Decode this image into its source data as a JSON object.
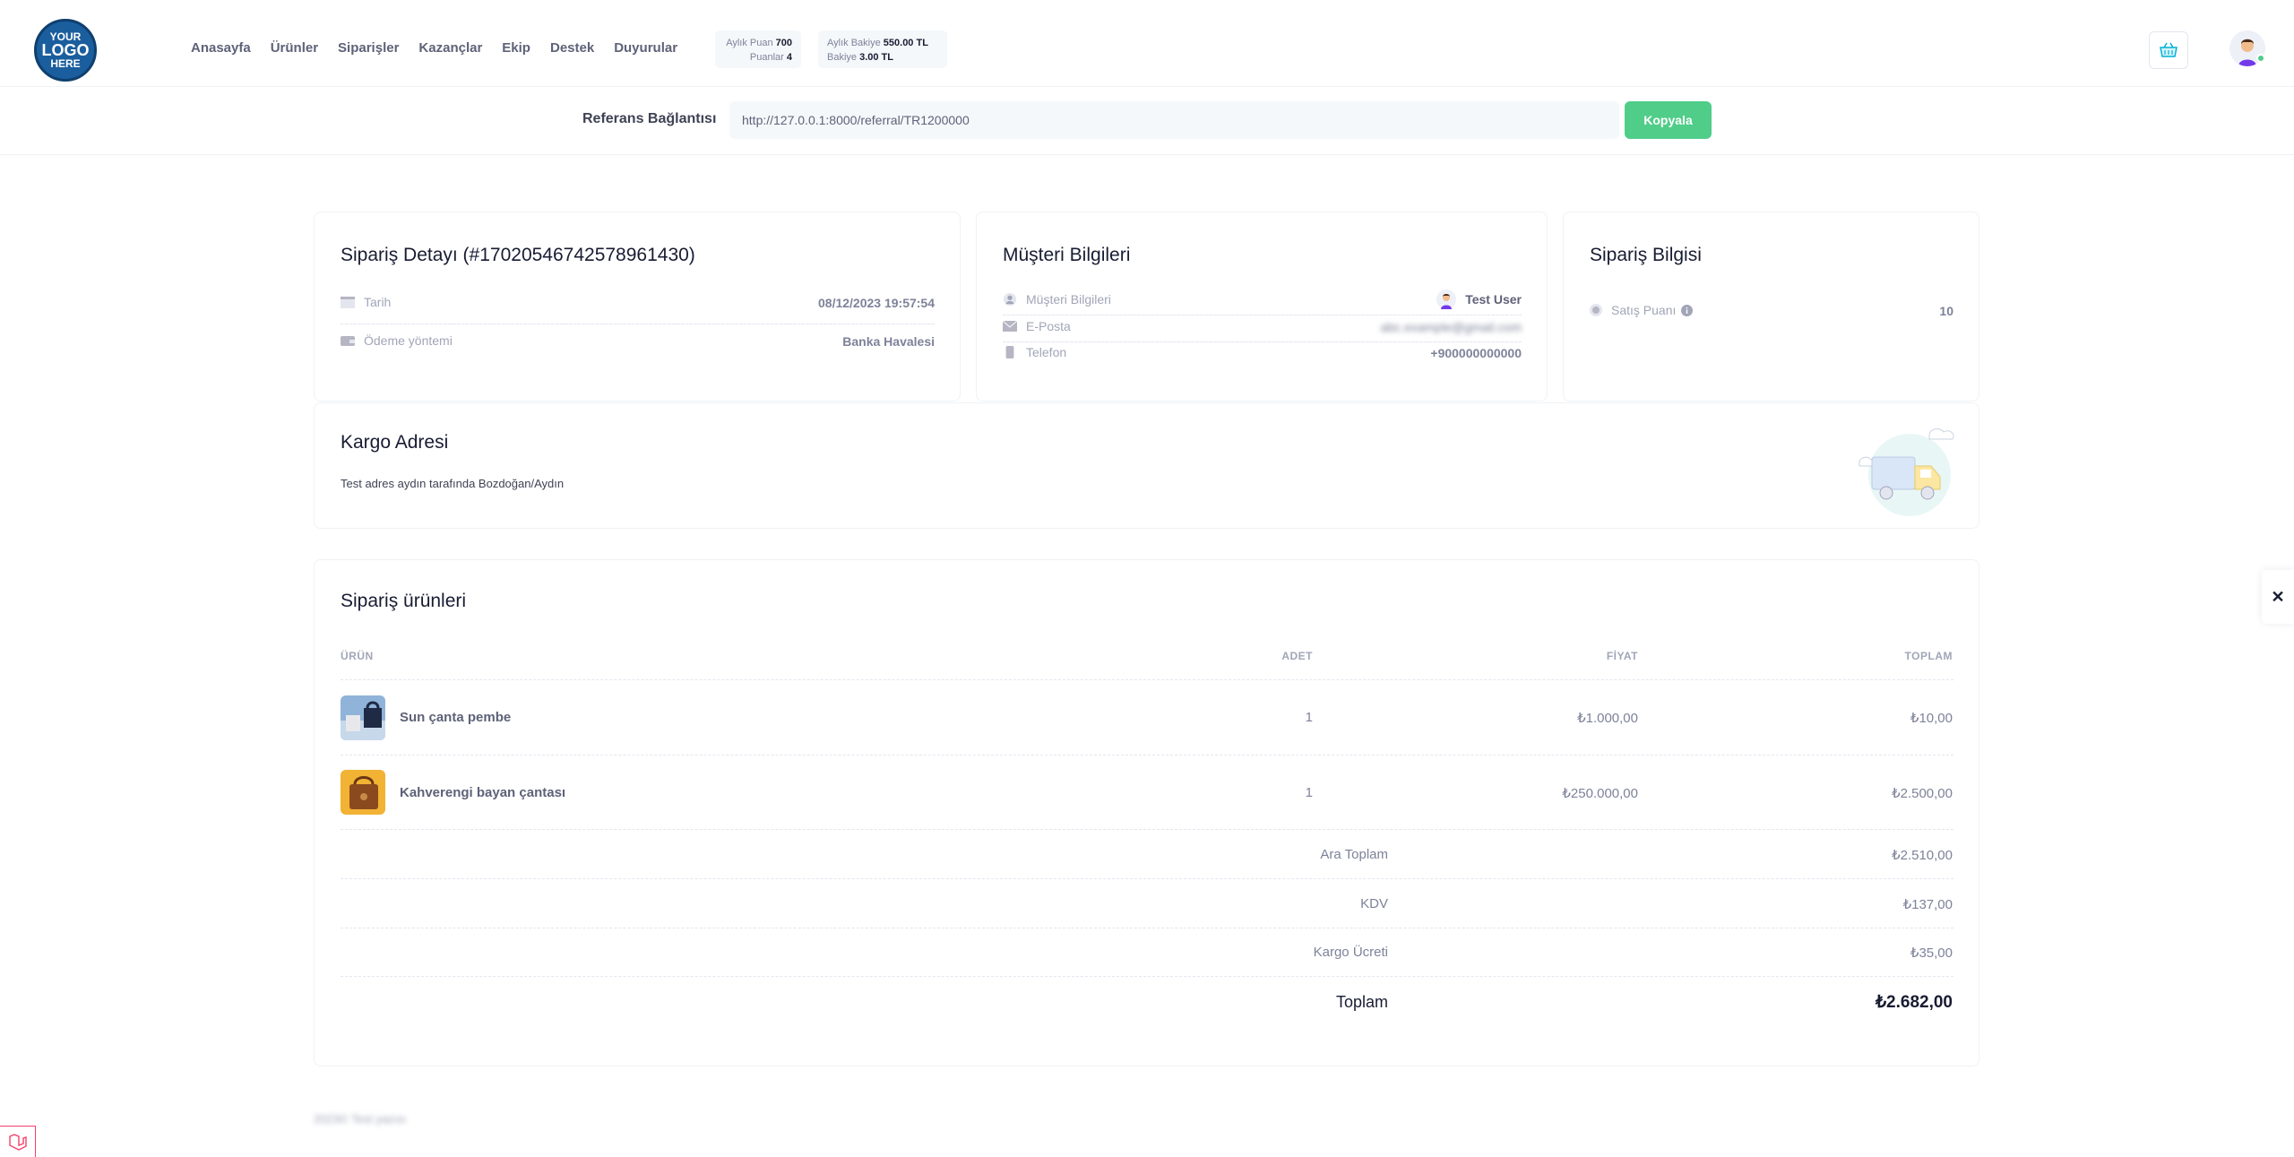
{
  "logo": {
    "line1": "YOUR",
    "line2": "LOGO",
    "line3": "HERE"
  },
  "nav": {
    "items": [
      "Anasayfa",
      "Ürünler",
      "Siparişler",
      "Kazançlar",
      "Ekip",
      "Destek",
      "Duyurular"
    ]
  },
  "stats": {
    "monthly_points_label": "Aylık Puan",
    "monthly_points": "700",
    "points_label": "Puanlar",
    "points": "4",
    "monthly_balance_label": "Aylık Bakiye",
    "monthly_balance": "550.00 TL",
    "balance_label": "Bakiye",
    "balance": "3.00 TL"
  },
  "referral": {
    "label": "Referans Bağlantısı",
    "url": "http://127.0.0.1:8000/referral/TR1200000",
    "copy_label": "Kopyala"
  },
  "order_detail": {
    "title": "Sipariş Detayı (#17020546742578961430)",
    "date_label": "Tarih",
    "date": "08/12/2023 19:57:54",
    "payment_label": "Ödeme yöntemi",
    "payment": "Banka Havalesi"
  },
  "customer": {
    "title": "Müşteri Bilgileri",
    "customer_label": "Müşteri Bilgileri",
    "customer_name": "Test User",
    "email_label": "E-Posta",
    "email": "abc.example@gmail.com",
    "phone_label": "Telefon",
    "phone": "+900000000000"
  },
  "order_info": {
    "title": "Sipariş Bilgisi",
    "points_label": "Satış Puanı",
    "points": "10"
  },
  "shipping": {
    "title": "Kargo Adresi",
    "address": "Test adres aydın tarafında Bozdoğan/Aydın"
  },
  "products": {
    "title": "Sipariş ürünleri",
    "headers": {
      "product": "ÜRÜN",
      "qty": "ADET",
      "price": "FİYAT",
      "total": "TOPLAM"
    },
    "rows": [
      {
        "name": "Sun çanta pembe",
        "qty": "1",
        "price": "₺1.000,00",
        "total": "₺10,00"
      },
      {
        "name": "Kahverengi bayan çantası",
        "qty": "1",
        "price": "₺250.000,00",
        "total": "₺2.500,00"
      }
    ],
    "subtotal_label": "Ara Toplam",
    "subtotal": "₺2.510,00",
    "vat_label": "KDV",
    "vat": "₺137,00",
    "shipping_label": "Kargo Ücreti",
    "shipping": "₺35,00",
    "grand_label": "Toplam",
    "grand": "₺2.682,00"
  },
  "footer": {
    "text": "2023© Test yazısı"
  },
  "close_label": "✕"
}
